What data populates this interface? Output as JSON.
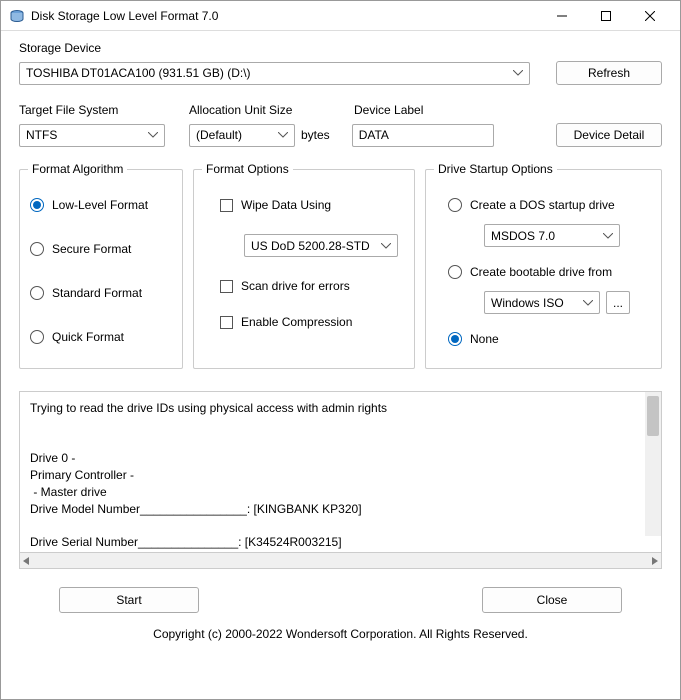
{
  "window": {
    "title": "Disk Storage Low Level Format 7.0"
  },
  "storage": {
    "label": "Storage Device",
    "selected": "TOSHIBA DT01ACA100 (931.51 GB) (D:\\)",
    "refresh": "Refresh"
  },
  "target_fs": {
    "label": "Target File System",
    "value": "NTFS"
  },
  "alloc": {
    "label": "Allocation Unit Size",
    "value": "(Default)",
    "unit": "bytes"
  },
  "device_label": {
    "label": "Device Label",
    "value": "DATA"
  },
  "device_detail": "Device Detail",
  "algo": {
    "legend": "Format Algorithm",
    "low": "Low-Level Format",
    "secure": "Secure Format",
    "standard": "Standard Format",
    "quick": "Quick Format"
  },
  "options": {
    "legend": "Format Options",
    "wipe": "Wipe Data Using",
    "wipe_method": "US DoD 5200.28-STD",
    "scan": "Scan drive for errors",
    "compress": "Enable Compression"
  },
  "startup": {
    "legend": "Drive Startup Options",
    "dos": "Create a DOS startup drive",
    "dos_value": "MSDOS 7.0",
    "boot": "Create bootable drive from",
    "boot_value": "Windows ISO",
    "browse": "...",
    "none": "None"
  },
  "log": "Trying to read the drive IDs using physical access with admin rights\n\n\nDrive 0 - \nPrimary Controller - \n - Master drive\nDrive Model Number________________: [KINGBANK KP320]\n\nDrive Serial Number_______________: [K34524R003215]",
  "start": "Start",
  "close": "Close",
  "copyright": "Copyright (c) 2000-2022 Wondersoft Corporation. All Rights Reserved."
}
